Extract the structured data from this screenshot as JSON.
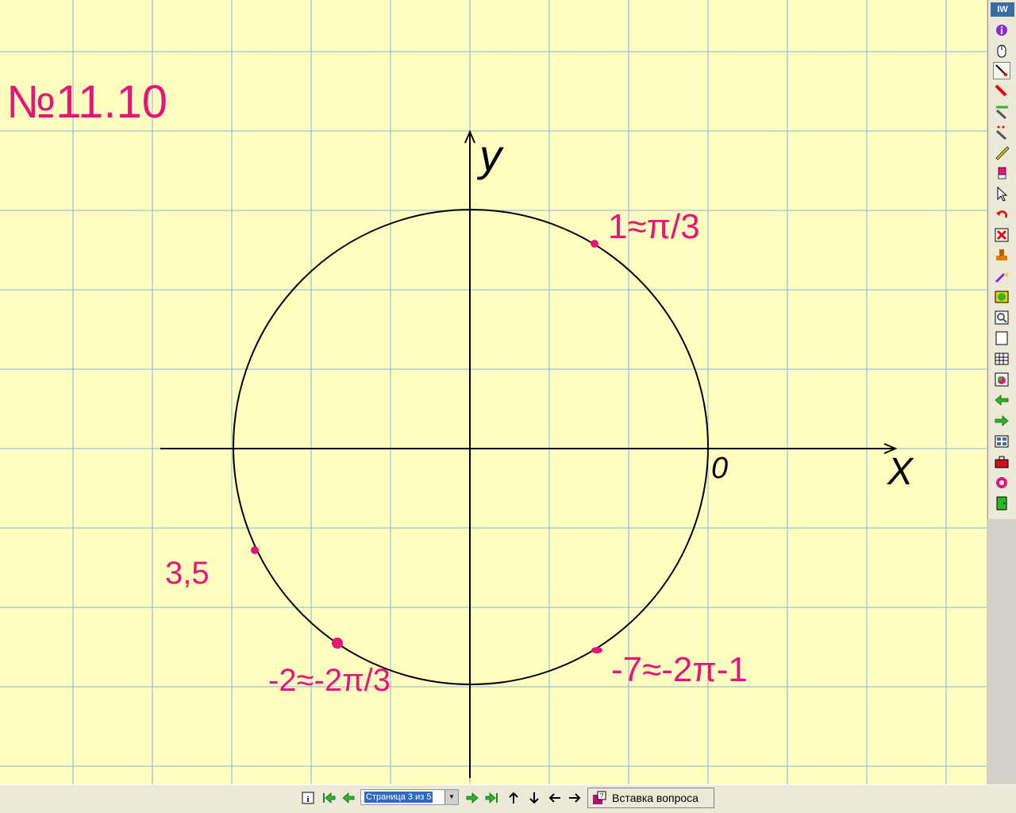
{
  "colors": {
    "paper": "#ffffc0",
    "grid": "#8ab2e6",
    "ink": "#000000",
    "marker": "#e8147a"
  },
  "canvas": {
    "task_number": "№11.10",
    "axis_x_label": "X",
    "axis_y_label": "y",
    "origin_label": "0",
    "annotations": {
      "point_top_right": "1≈π/3",
      "point_left": "3,5",
      "point_bottom_left": "-2≈-2π/3",
      "point_bottom_right": "-7≈-2π-1"
    }
  },
  "toolbar": {
    "logo": "IW",
    "icons": [
      "info-icon",
      "mouse-icon",
      "pen-tool-icon",
      "marker-icon",
      "highlighter-icon",
      "magic-pen-icon",
      "ruler-icon",
      "eraser-icon",
      "pointer-icon",
      "undo-icon",
      "delete-icon",
      "stamp-icon",
      "magic-wand-icon",
      "image-icon",
      "search-icon",
      "blank-page-icon",
      "grid-page-icon",
      "insert-image-icon",
      "prev-page-icon",
      "next-page-icon",
      "page-sorter-icon",
      "toolbox-icon",
      "help-icon",
      "exit-icon"
    ]
  },
  "bottombar": {
    "page_select": "Страница 3 из 5",
    "insert_question": "Вставка вопроса"
  }
}
